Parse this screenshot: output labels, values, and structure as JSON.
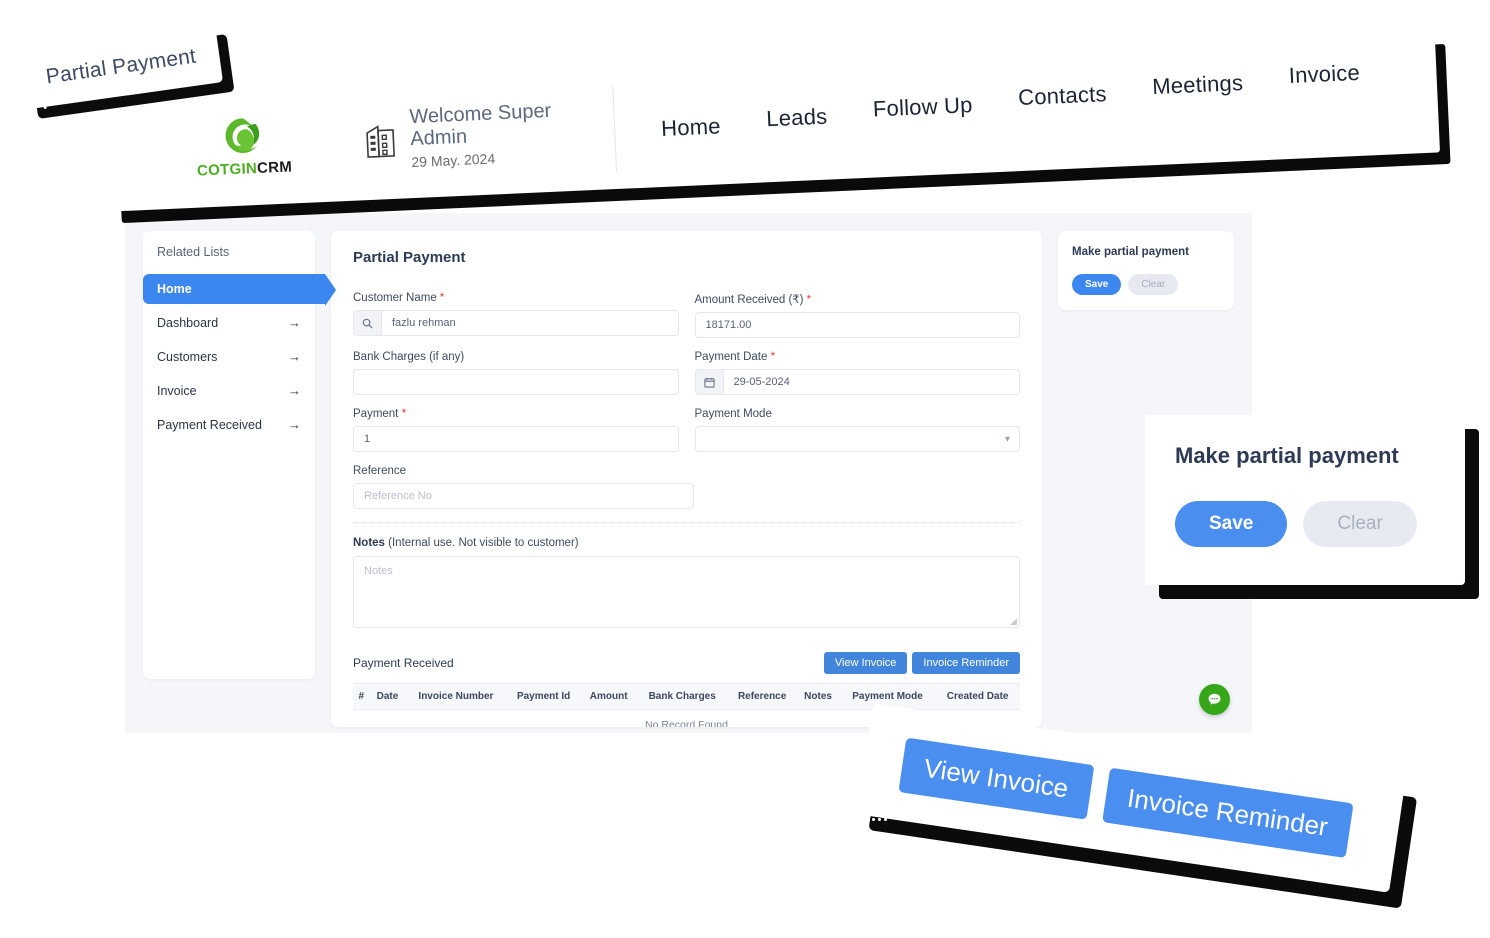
{
  "callouts": {
    "top_left_label": "Partial Payment",
    "zoom_card": {
      "title": "Make partial payment",
      "save_label": "Save",
      "clear_label": "Clear"
    },
    "zoom_invoice": {
      "view_invoice_label": "View Invoice",
      "invoice_reminder_label": "Invoice Reminder"
    }
  },
  "brand": {
    "name_green": "COTGIN",
    "name_dark": "CRM",
    "logo_icon": "swirl-leaf-c-icon",
    "accent_green": "#4caf21"
  },
  "header": {
    "building_icon": "building-icon",
    "welcome": "Welcome Super Admin",
    "date": "29 May. 2024",
    "nav": [
      {
        "label": "Home"
      },
      {
        "label": "Leads"
      },
      {
        "label": "Follow Up"
      },
      {
        "label": "Contacts"
      },
      {
        "label": "Meetings"
      },
      {
        "label": "Invoice"
      }
    ]
  },
  "sidebar": {
    "title": "Related Lists",
    "items": [
      {
        "label": "Home",
        "active": true,
        "arrow": ""
      },
      {
        "label": "Dashboard",
        "active": false,
        "arrow": "→"
      },
      {
        "label": "Customers",
        "active": false,
        "arrow": "→"
      },
      {
        "label": "Invoice",
        "active": false,
        "arrow": "→"
      },
      {
        "label": "Payment Received",
        "active": false,
        "arrow": "→"
      }
    ]
  },
  "form": {
    "page_title": "Partial Payment",
    "customer_name": {
      "label": "Customer Name",
      "required": true,
      "icon": "search-icon",
      "value": "fazlu rehman"
    },
    "amount_received": {
      "label": "Amount Received (₹)",
      "required": true,
      "value": "18171.00"
    },
    "bank_charges": {
      "label": "Bank Charges (if any)",
      "required": false,
      "value": ""
    },
    "payment_date": {
      "label": "Payment Date",
      "required": true,
      "icon": "calendar-icon",
      "value": "29-05-2024"
    },
    "payment": {
      "label": "Payment",
      "required": true,
      "value": "1"
    },
    "payment_mode": {
      "label": "Payment Mode",
      "required": false,
      "value": "",
      "caret": "chevron-down-icon"
    },
    "reference": {
      "label": "Reference",
      "required": false,
      "value": "",
      "placeholder": "Reference No"
    },
    "notes": {
      "label_bold": "Notes",
      "label_rest": " (Internal use. Not visible to customer)",
      "value": "",
      "placeholder": "Notes"
    }
  },
  "table": {
    "title": "Payment Received",
    "buttons": {
      "view_invoice": "View Invoice",
      "invoice_reminder": "Invoice Reminder"
    },
    "columns": [
      "#",
      "Date",
      "Invoice Number",
      "Payment Id",
      "Amount",
      "Bank Charges",
      "Reference",
      "Notes",
      "Payment Mode",
      "Created Date"
    ],
    "rows": [],
    "empty_text": "No Record Found"
  },
  "rail": {
    "title": "Make partial payment",
    "save_label": "Save",
    "clear_label": "Clear"
  },
  "chat": {
    "icon": "chat-bubble-icon",
    "color": "#35a718"
  },
  "colors": {
    "primary_blue": "#3c86ef",
    "button_blue": "#4285dd",
    "page_bg": "#f4f6fa",
    "required_red": "#e03a3a"
  }
}
